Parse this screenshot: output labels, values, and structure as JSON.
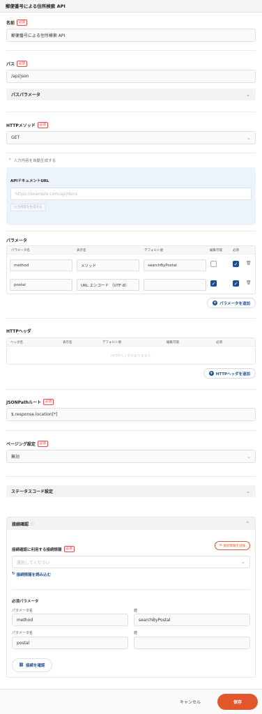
{
  "header": {
    "title": "郵便番号による住所検索 API"
  },
  "required": "必須",
  "name": {
    "label": "名前",
    "value": "郵便番号による住所検索 API"
  },
  "path": {
    "label": "パス",
    "value": "/api/json",
    "params_label": "パスパラメータ"
  },
  "method": {
    "label": "HTTPメソッド",
    "value": "GET"
  },
  "autogen": {
    "toggle_label": "入力内容を自動生成する",
    "doc_label": "APIドキュメントURL",
    "doc_placeholder": "https://example.com/api/docs",
    "generate_button": "入力内容を生成する"
  },
  "params": {
    "label": "パラメータ",
    "columns": [
      "パラメータ名",
      "表示名",
      "デフォルト値",
      "編集可能",
      "必須"
    ],
    "rows": [
      {
        "name": "method",
        "display": "メソッド",
        "default": "searchByPostal",
        "editable": false,
        "required": true
      },
      {
        "name": "postal",
        "display": "URL エンコード （UTF-8）",
        "default": "",
        "editable": true,
        "required": true
      }
    ],
    "add_button": "パラメータを追加"
  },
  "headers": {
    "label": "HTTPヘッダ",
    "columns": [
      "ヘッダ名",
      "表示名",
      "デフォルト値",
      "編集可能",
      "必須"
    ],
    "empty": "HTTPヘッダがありません",
    "add_button": "HTTPヘッダを追加"
  },
  "jsonpath": {
    "label": "JSONPathルート",
    "value": "$.response.location[*]"
  },
  "paging": {
    "label": "ページング設定",
    "value": "無効"
  },
  "status": {
    "label": "ステータスコード設定"
  },
  "conn": {
    "label": "接続確認",
    "cred_label": "接続確認に利用する接続情報",
    "add_cred_button": "接続情報を追加",
    "select_placeholder": "選択してください",
    "load_link": "接続情報を読み込む",
    "req_params_label": "必須パラメータ",
    "name_col": "パラメータ名",
    "value_col": "値",
    "rows": [
      {
        "name": "method",
        "value": "searchByPostal"
      },
      {
        "name": "postal",
        "value": ""
      }
    ],
    "check_button": "接続を確認"
  },
  "footer": {
    "cancel": "キャンセル",
    "save": "保存"
  },
  "colors": {
    "accent": "#e2562b",
    "primary": "#1f4e8c",
    "required": "#e05050"
  }
}
